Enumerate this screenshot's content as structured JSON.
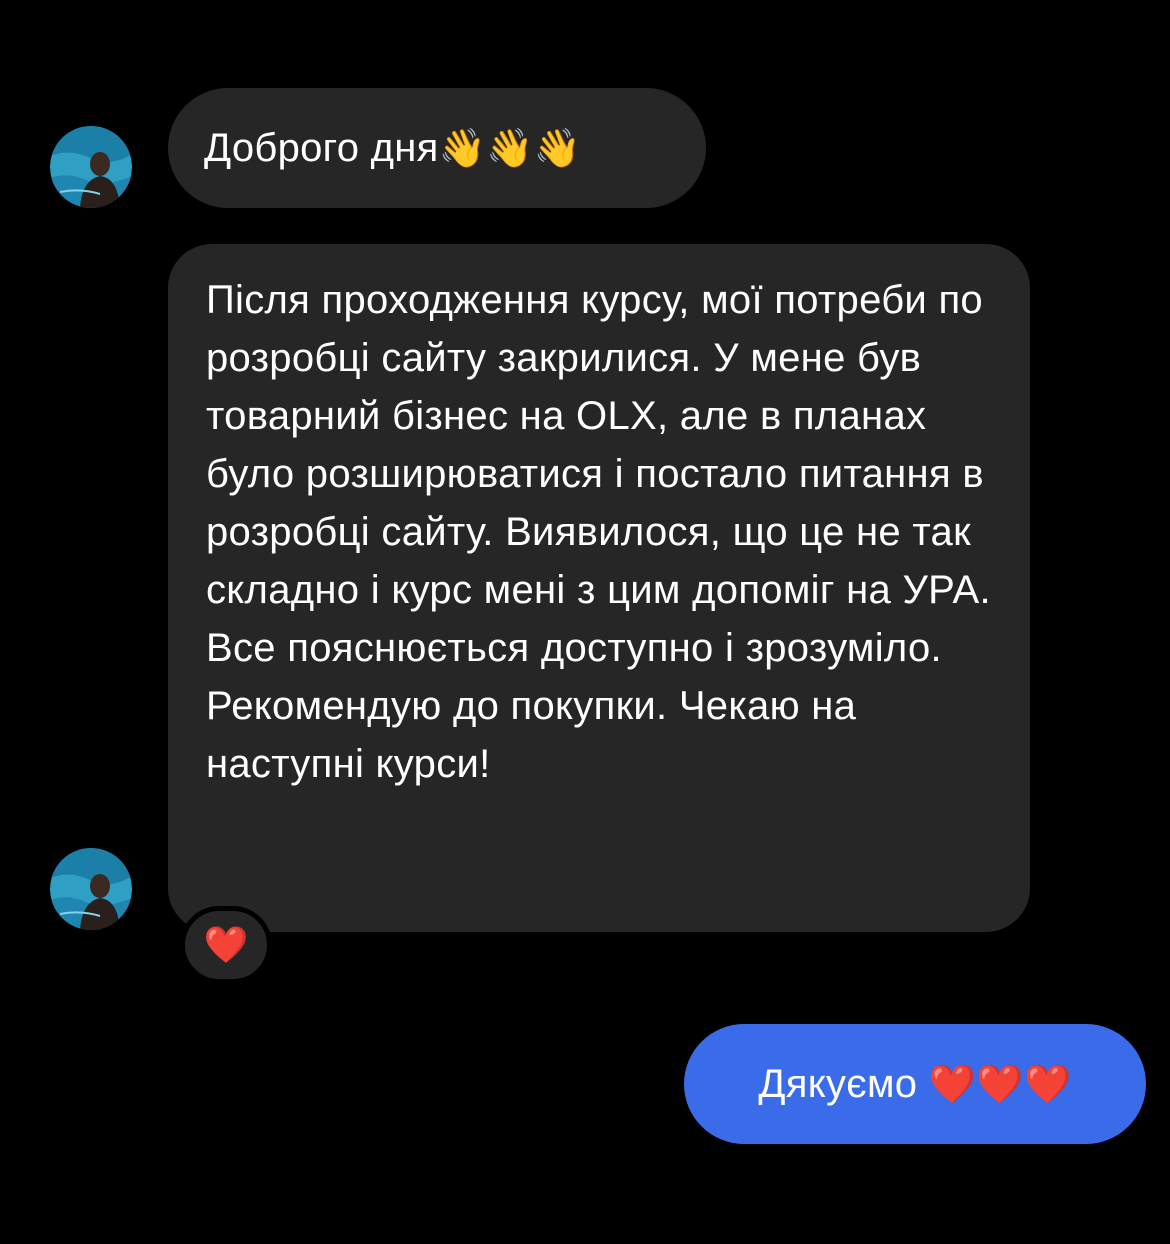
{
  "conversation": {
    "messages": [
      {
        "direction": "incoming",
        "text": "Доброго дня",
        "emoji": "👋👋👋"
      },
      {
        "direction": "incoming",
        "text": "Після проходження курсу, мої потреби по розробці сайту закрилися. У мене був товарний бізнес на OLX, але в планах було розширюватися і постало питання в розробці сайту. Виявилося, що це не так складно і курс мені з цим допоміг на УРА. Все пояснюється доступно і зрозуміло. Рекомендую до покупки. Чекаю на наступні курси!",
        "reaction": "❤️"
      },
      {
        "direction": "outgoing",
        "text": "Дякуємо",
        "emoji": "❤️❤️❤️"
      }
    ]
  },
  "colors": {
    "background": "#000000",
    "incoming_bubble": "#262626",
    "outgoing_bubble": "#3a6cea",
    "text": "#ffffff",
    "heart": "#e8192c",
    "wave_hand": "#f7c13b"
  },
  "icons": {
    "avatar": "user-avatar-photo",
    "wave": "waving-hand-icon",
    "heart": "red-heart-icon"
  }
}
